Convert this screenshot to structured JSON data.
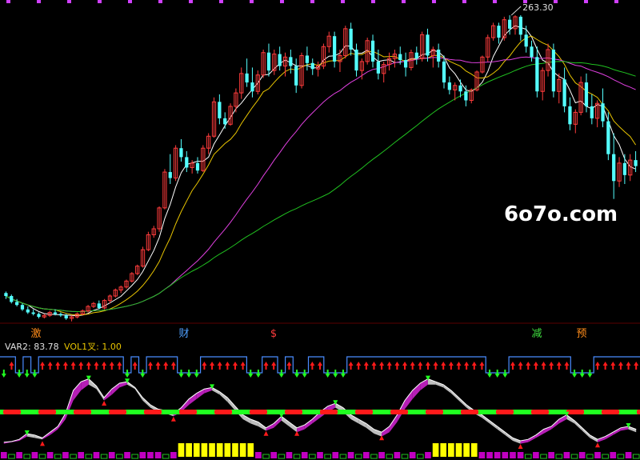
{
  "watermark": "6o7o.com",
  "indicator_labels": {
    "var2": "VAR2: 83.78",
    "vol1": "VOL1叉: 1.00"
  },
  "colors": {
    "background": "#000000",
    "up": "#ff3c3c",
    "down": "#54ffff",
    "ma_white": "#ffffff",
    "ma_yellow": "#e8c400",
    "ma_magenta": "#e040e0",
    "ma_green": "#20c020",
    "ma_darkgreen": "#1a8a1a",
    "bar_yellow": "#ffff00",
    "bar_magenta": "#c000c0",
    "signal_blue": "#4a8cff",
    "arrow_red": "#ff1a1a",
    "arrow_green": "#20ff20"
  },
  "chart_data": [
    {
      "type": "candlestick",
      "annotations": [
        {
          "label": "263.30",
          "series": "high"
        }
      ],
      "markers": [
        {
          "text": "激",
          "color": "#ff8c1a"
        },
        {
          "text": "财",
          "color": "#4fa0ff"
        },
        {
          "text": "$",
          "color": "#ff3c3c"
        },
        {
          "text": "减",
          "color": "#40e040"
        },
        {
          "text": "预",
          "color": "#ff8c1a"
        }
      ],
      "ylim": [
        60,
        270
      ],
      "candles": [
        [
          77,
          78,
          73,
          75
        ],
        [
          75,
          76,
          70,
          71
        ],
        [
          71,
          73,
          68,
          69
        ],
        [
          69,
          70,
          65,
          66
        ],
        [
          66,
          68,
          63,
          64
        ],
        [
          64,
          66,
          62,
          63
        ],
        [
          63,
          64,
          60,
          61
        ],
        [
          61,
          63,
          60,
          62
        ],
        [
          62,
          65,
          61,
          64
        ],
        [
          64,
          66,
          62,
          63
        ],
        [
          63,
          64,
          61,
          62
        ],
        [
          62,
          63,
          59,
          60
        ],
        [
          60,
          62,
          58,
          61
        ],
        [
          61,
          64,
          60,
          63
        ],
        [
          63,
          66,
          62,
          65
        ],
        [
          65,
          69,
          64,
          68
        ],
        [
          68,
          71,
          67,
          70
        ],
        [
          70,
          72,
          66,
          67
        ],
        [
          67,
          73,
          66,
          72
        ],
        [
          72,
          76,
          70,
          75
        ],
        [
          75,
          80,
          74,
          79
        ],
        [
          79,
          82,
          77,
          81
        ],
        [
          81,
          86,
          80,
          85
        ],
        [
          85,
          91,
          84,
          90
        ],
        [
          90,
          96,
          89,
          95
        ],
        [
          95,
          108,
          94,
          106
        ],
        [
          106,
          118,
          105,
          116
        ],
        [
          116,
          122,
          114,
          120
        ],
        [
          120,
          135,
          118,
          134
        ],
        [
          134,
          160,
          133,
          158
        ],
        [
          158,
          170,
          150,
          154
        ],
        [
          154,
          176,
          152,
          174
        ],
        [
          174,
          180,
          165,
          168
        ],
        [
          168,
          172,
          158,
          161
        ],
        [
          161,
          166,
          157,
          164
        ],
        [
          164,
          168,
          157,
          159
        ],
        [
          159,
          176,
          158,
          174
        ],
        [
          174,
          184,
          170,
          182
        ],
        [
          182,
          208,
          181,
          205
        ],
        [
          205,
          210,
          190,
          194
        ],
        [
          194,
          198,
          187,
          190
        ],
        [
          190,
          204,
          189,
          202
        ],
        [
          202,
          214,
          198,
          211
        ],
        [
          211,
          228,
          207,
          224
        ],
        [
          224,
          234,
          215,
          218
        ],
        [
          218,
          228,
          208,
          212
        ],
        [
          212,
          226,
          210,
          223
        ],
        [
          223,
          240,
          221,
          238
        ],
        [
          238,
          244,
          222,
          226
        ],
        [
          226,
          240,
          223,
          237
        ],
        [
          237,
          242,
          226,
          229
        ],
        [
          229,
          238,
          222,
          235
        ],
        [
          235,
          240,
          224,
          229
        ],
        [
          229,
          234,
          211,
          216
        ],
        [
          216,
          238,
          214,
          236
        ],
        [
          236,
          242,
          226,
          231
        ],
        [
          231,
          234,
          223,
          227
        ],
        [
          227,
          232,
          222,
          229
        ],
        [
          229,
          244,
          227,
          242
        ],
        [
          242,
          252,
          238,
          249
        ],
        [
          249,
          252,
          228,
          232
        ],
        [
          232,
          240,
          225,
          236
        ],
        [
          236,
          256,
          234,
          254
        ],
        [
          254,
          258,
          236,
          240
        ],
        [
          240,
          244,
          222,
          226
        ],
        [
          226,
          234,
          220,
          232
        ],
        [
          232,
          248,
          230,
          246
        ],
        [
          246,
          250,
          228,
          232
        ],
        [
          232,
          240,
          220,
          224
        ],
        [
          224,
          232,
          218,
          230
        ],
        [
          230,
          238,
          226,
          234
        ],
        [
          234,
          240,
          228,
          237
        ],
        [
          237,
          242,
          230,
          233
        ],
        [
          233,
          238,
          222,
          228
        ],
        [
          228,
          240,
          226,
          238
        ],
        [
          238,
          242,
          230,
          234
        ],
        [
          234,
          252,
          232,
          250
        ],
        [
          250,
          254,
          232,
          236
        ],
        [
          236,
          242,
          228,
          240
        ],
        [
          240,
          244,
          228,
          232
        ],
        [
          232,
          236,
          214,
          218
        ],
        [
          218,
          222,
          210,
          213
        ],
        [
          213,
          218,
          206,
          216
        ],
        [
          216,
          220,
          208,
          212
        ],
        [
          212,
          216,
          202,
          206
        ],
        [
          206,
          214,
          204,
          213
        ],
        [
          213,
          226,
          212,
          225
        ],
        [
          225,
          236,
          224,
          235
        ],
        [
          235,
          250,
          232,
          248
        ],
        [
          248,
          258,
          246,
          256
        ],
        [
          256,
          258,
          244,
          248
        ],
        [
          248,
          262,
          246,
          260
        ],
        [
          260,
          263,
          250,
          254
        ],
        [
          254,
          263,
          250,
          262
        ],
        [
          262,
          263,
          246,
          250
        ],
        [
          250,
          256,
          238,
          242
        ],
        [
          242,
          246,
          232,
          235
        ],
        [
          235,
          242,
          208,
          212
        ],
        [
          212,
          228,
          206,
          226
        ],
        [
          226,
          244,
          222,
          240
        ],
        [
          240,
          244,
          208,
          212
        ],
        [
          212,
          224,
          204,
          220
        ],
        [
          220,
          228,
          198,
          202
        ],
        [
          202,
          208,
          186,
          190
        ],
        [
          190,
          200,
          184,
          198
        ],
        [
          198,
          222,
          196,
          218
        ],
        [
          218,
          224,
          198,
          202
        ],
        [
          202,
          210,
          190,
          194
        ],
        [
          194,
          206,
          188,
          204
        ],
        [
          204,
          214,
          188,
          192
        ],
        [
          192,
          198,
          166,
          170
        ],
        [
          170,
          184,
          140,
          152
        ],
        [
          152,
          168,
          148,
          164
        ],
        [
          164,
          170,
          150,
          156
        ],
        [
          156,
          170,
          152,
          166
        ],
        [
          166,
          172,
          158,
          162
        ]
      ],
      "ma_series": [
        {
          "key": "ma5",
          "period": 5,
          "color": "#ffffff"
        },
        {
          "key": "ma10",
          "period": 10,
          "color": "#e8c400"
        },
        {
          "key": "ma30",
          "period": 30,
          "color": "#e040e0"
        },
        {
          "key": "ma60",
          "period": 60,
          "color": "#20c020"
        }
      ]
    },
    {
      "type": "area",
      "signal_step": [
        1,
        1,
        0,
        1,
        0,
        1,
        1,
        1,
        1,
        1,
        1,
        1,
        1,
        1,
        1,
        1,
        0,
        1,
        0,
        1,
        1,
        1,
        1,
        0,
        0,
        0,
        1,
        1,
        1,
        1,
        1,
        1,
        0,
        0,
        1,
        1,
        0,
        1,
        0,
        0,
        1,
        1,
        0,
        0,
        0,
        1,
        1,
        1,
        1,
        1,
        1,
        1,
        1,
        1,
        1,
        1,
        1,
        1,
        1,
        1,
        1,
        1,
        1,
        0,
        0,
        0,
        1,
        1,
        1,
        1,
        1,
        1,
        1,
        1,
        0,
        0,
        0,
        1,
        1,
        1,
        1,
        1,
        1
      ],
      "arrows_up": [
        0,
        1,
        0,
        0,
        0,
        1,
        1,
        1,
        1,
        1,
        1,
        1,
        1,
        1,
        1,
        1,
        0,
        1,
        0,
        1,
        1,
        1,
        1,
        0,
        0,
        0,
        1,
        1,
        1,
        1,
        1,
        1,
        0,
        0,
        1,
        1,
        0,
        1,
        0,
        0,
        1,
        1,
        0,
        0,
        0,
        1,
        1,
        1,
        1,
        1,
        1,
        1,
        1,
        1,
        1,
        1,
        1,
        1,
        1,
        1,
        1,
        1,
        1,
        0,
        0,
        0,
        1,
        1,
        1,
        1,
        1,
        1,
        1,
        1,
        0,
        0,
        0,
        1,
        1,
        1,
        1,
        1,
        1
      ],
      "osc_a": [
        8,
        9,
        12,
        20,
        18,
        14,
        22,
        30,
        48,
        80,
        92,
        96,
        86,
        70,
        82,
        90,
        92,
        84,
        70,
        60,
        54,
        52,
        48,
        56,
        68,
        76,
        82,
        84,
        78,
        70,
        58,
        46,
        40,
        36,
        28,
        34,
        44,
        36,
        28,
        32,
        40,
        50,
        58,
        62,
        56,
        46,
        40,
        34,
        26,
        22,
        30,
        46,
        66,
        80,
        90,
        96,
        92,
        88,
        80,
        70,
        60,
        52,
        46,
        38,
        30,
        22,
        14,
        10,
        12,
        18,
        26,
        30,
        40,
        46,
        38,
        28,
        18,
        12,
        16,
        22,
        28,
        30,
        26
      ],
      "osc_b": [
        6,
        8,
        10,
        16,
        14,
        12,
        18,
        26,
        40,
        66,
        80,
        88,
        82,
        66,
        74,
        84,
        88,
        82,
        66,
        56,
        50,
        48,
        44,
        50,
        60,
        68,
        76,
        80,
        74,
        64,
        52,
        40,
        34,
        30,
        24,
        28,
        38,
        30,
        22,
        26,
        34,
        42,
        50,
        56,
        50,
        40,
        34,
        28,
        20,
        16,
        22,
        36,
        54,
        68,
        80,
        88,
        88,
        84,
        76,
        66,
        56,
        48,
        42,
        34,
        26,
        18,
        10,
        6,
        8,
        14,
        20,
        26,
        34,
        40,
        34,
        24,
        14,
        8,
        12,
        18,
        24,
        26,
        22
      ],
      "threshold": 50,
      "hist_yellow": [
        0,
        0,
        0,
        0,
        0,
        0,
        0,
        0,
        0,
        0,
        0,
        0,
        0,
        0,
        0,
        0,
        0,
        0,
        0,
        0,
        0,
        0,
        0,
        1,
        1,
        1,
        1,
        1,
        1,
        1,
        1,
        1,
        1,
        0,
        0,
        0,
        0,
        0,
        0,
        0,
        0,
        0,
        0,
        0,
        0,
        0,
        0,
        0,
        0,
        0,
        0,
        0,
        0,
        0,
        0,
        0,
        1,
        1,
        1,
        1,
        1,
        1,
        0,
        0,
        0,
        0,
        0,
        0,
        0,
        0,
        0,
        0,
        0,
        0,
        0,
        0,
        0,
        0,
        0,
        0,
        0,
        0,
        0
      ],
      "hist_magenta": [
        1,
        0,
        1,
        0,
        1,
        0,
        1,
        0,
        1,
        0,
        1,
        0,
        1,
        0,
        1,
        0,
        1,
        0,
        1,
        1,
        1,
        0,
        1,
        0,
        0,
        0,
        0,
        0,
        0,
        0,
        0,
        0,
        0,
        1,
        0,
        1,
        0,
        1,
        0,
        1,
        0,
        1,
        0,
        1,
        0,
        1,
        0,
        1,
        0,
        1,
        0,
        1,
        0,
        1,
        0,
        1,
        0,
        0,
        0,
        0,
        0,
        0,
        1,
        1,
        1,
        1,
        1,
        1,
        0,
        1,
        0,
        1,
        0,
        1,
        0,
        1,
        0,
        1,
        0,
        1,
        0,
        1,
        0
      ]
    }
  ]
}
